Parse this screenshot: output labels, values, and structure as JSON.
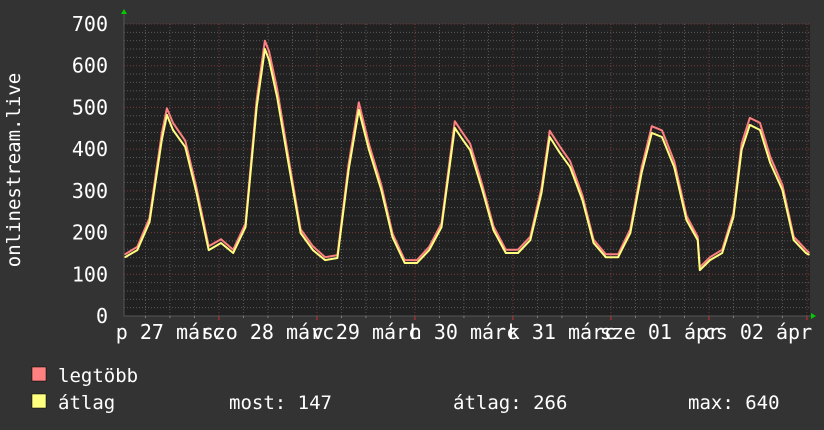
{
  "colors": {
    "background": "#333333",
    "plot_background": "#212121",
    "minor_grid": "#5a5a5a",
    "major_grid": "#7a3a3a",
    "axis_arrow": "#00cc00",
    "max_series": "#ff8080",
    "avg_series": "#ffff80",
    "text": "#ffffff"
  },
  "chart_data": {
    "type": "line",
    "ylabel": "onlinestream.live",
    "ylim": [
      0,
      700
    ],
    "yticks": [
      "0",
      "100",
      "200",
      "300",
      "400",
      "500",
      "600",
      "700"
    ],
    "xlim": [
      "03-27 00:45",
      "04-03 00:45"
    ],
    "xtick_labels": [
      {
        "at": "03-27 12:00",
        "label": "p 27 márc"
      },
      {
        "at": "03-28 12:00",
        "label": "szo 28 márc"
      },
      {
        "at": "03-29 12:00",
        "label": "v 29 márc"
      },
      {
        "at": "03-30 12:00",
        "label": "h 30 márc"
      },
      {
        "at": "03-31 12:00",
        "label": "k 31 márc"
      },
      {
        "at": "04-01 12:00",
        "label": "sze 01 ápr"
      },
      {
        "at": "04-02 12:00",
        "label": "cs 02 ápr"
      }
    ],
    "grid": true,
    "x": [
      "03-27 01:00",
      "03-27 04:00",
      "03-27 07:00",
      "03-27 10:00",
      "03-27 11:15",
      "03-27 12:45",
      "03-27 15:45",
      "03-27 18:30",
      "03-27 21:30",
      "03-28 00:30",
      "03-28 03:30",
      "03-28 06:30",
      "03-28 09:15",
      "03-28 11:15",
      "03-28 12:15",
      "03-28 14:15",
      "03-28 17:00",
      "03-28 20:00",
      "03-28 23:00",
      "03-29 02:00",
      "03-29 05:00",
      "03-29 07:45",
      "03-29 10:15",
      "03-29 12:45",
      "03-29 15:45",
      "03-29 18:30",
      "03-29 21:30",
      "03-30 00:30",
      "03-30 03:30",
      "03-30 06:30",
      "03-30 09:45",
      "03-30 11:45",
      "03-30 13:30",
      "03-30 16:30",
      "03-30 19:15",
      "03-30 22:15",
      "03-31 01:15",
      "03-31 04:15",
      "03-31 07:00",
      "03-31 09:00",
      "03-31 11:30",
      "03-31 14:00",
      "03-31 17:00",
      "03-31 19:45",
      "03-31 22:45",
      "04-01 01:45",
      "04-01 04:45",
      "04-01 07:30",
      "04-01 10:00",
      "04-01 12:30",
      "04-01 15:30",
      "04-01 18:30",
      "04-01 21:15",
      "04-01 21:45",
      "04-02 00:15",
      "04-02 03:15",
      "04-02 06:00",
      "04-02 08:00",
      "04-02 10:00",
      "04-02 12:30",
      "04-02 15:00",
      "04-02 18:00",
      "04-02 20:45",
      "04-02 23:45",
      "04-03 00:30"
    ],
    "series": [
      {
        "name": "legtöbb",
        "color": "#ff8080",
        "values": [
          148,
          166,
          235,
          438,
          498,
          463,
          420,
          307,
          167,
          184,
          159,
          222,
          519,
          660,
          635,
          545,
          381,
          208,
          167,
          141,
          146,
          364,
          512,
          412,
          314,
          198,
          134,
          134,
          166,
          222,
          467,
          438,
          413,
          314,
          215,
          159,
          159,
          190,
          307,
          444,
          406,
          371,
          289,
          183,
          148,
          148,
          208,
          356,
          455,
          445,
          371,
          240,
          190,
          117,
          141,
          159,
          247,
          413,
          475,
          463,
          382,
          314,
          190,
          159,
          152
        ]
      },
      {
        "name": "átlag",
        "color": "#ffff80",
        "values": [
          141,
          158,
          225,
          422,
          482,
          446,
          405,
          295,
          158,
          175,
          151,
          213,
          501,
          640,
          614,
          525,
          367,
          199,
          158,
          134,
          139,
          350,
          494,
          398,
          302,
          189,
          127,
          127,
          158,
          213,
          451,
          422,
          398,
          302,
          206,
          151,
          151,
          182,
          295,
          429,
          391,
          357,
          278,
          175,
          141,
          141,
          199,
          343,
          439,
          429,
          357,
          230,
          182,
          110,
          134,
          151,
          237,
          398,
          458,
          446,
          367,
          302,
          182,
          151,
          147
        ]
      }
    ]
  },
  "legend": {
    "max_label": "legtöbb",
    "avg_label": "átlag",
    "current": "most: 147",
    "average": "átlag: 266",
    "maximum": "max: 640"
  }
}
